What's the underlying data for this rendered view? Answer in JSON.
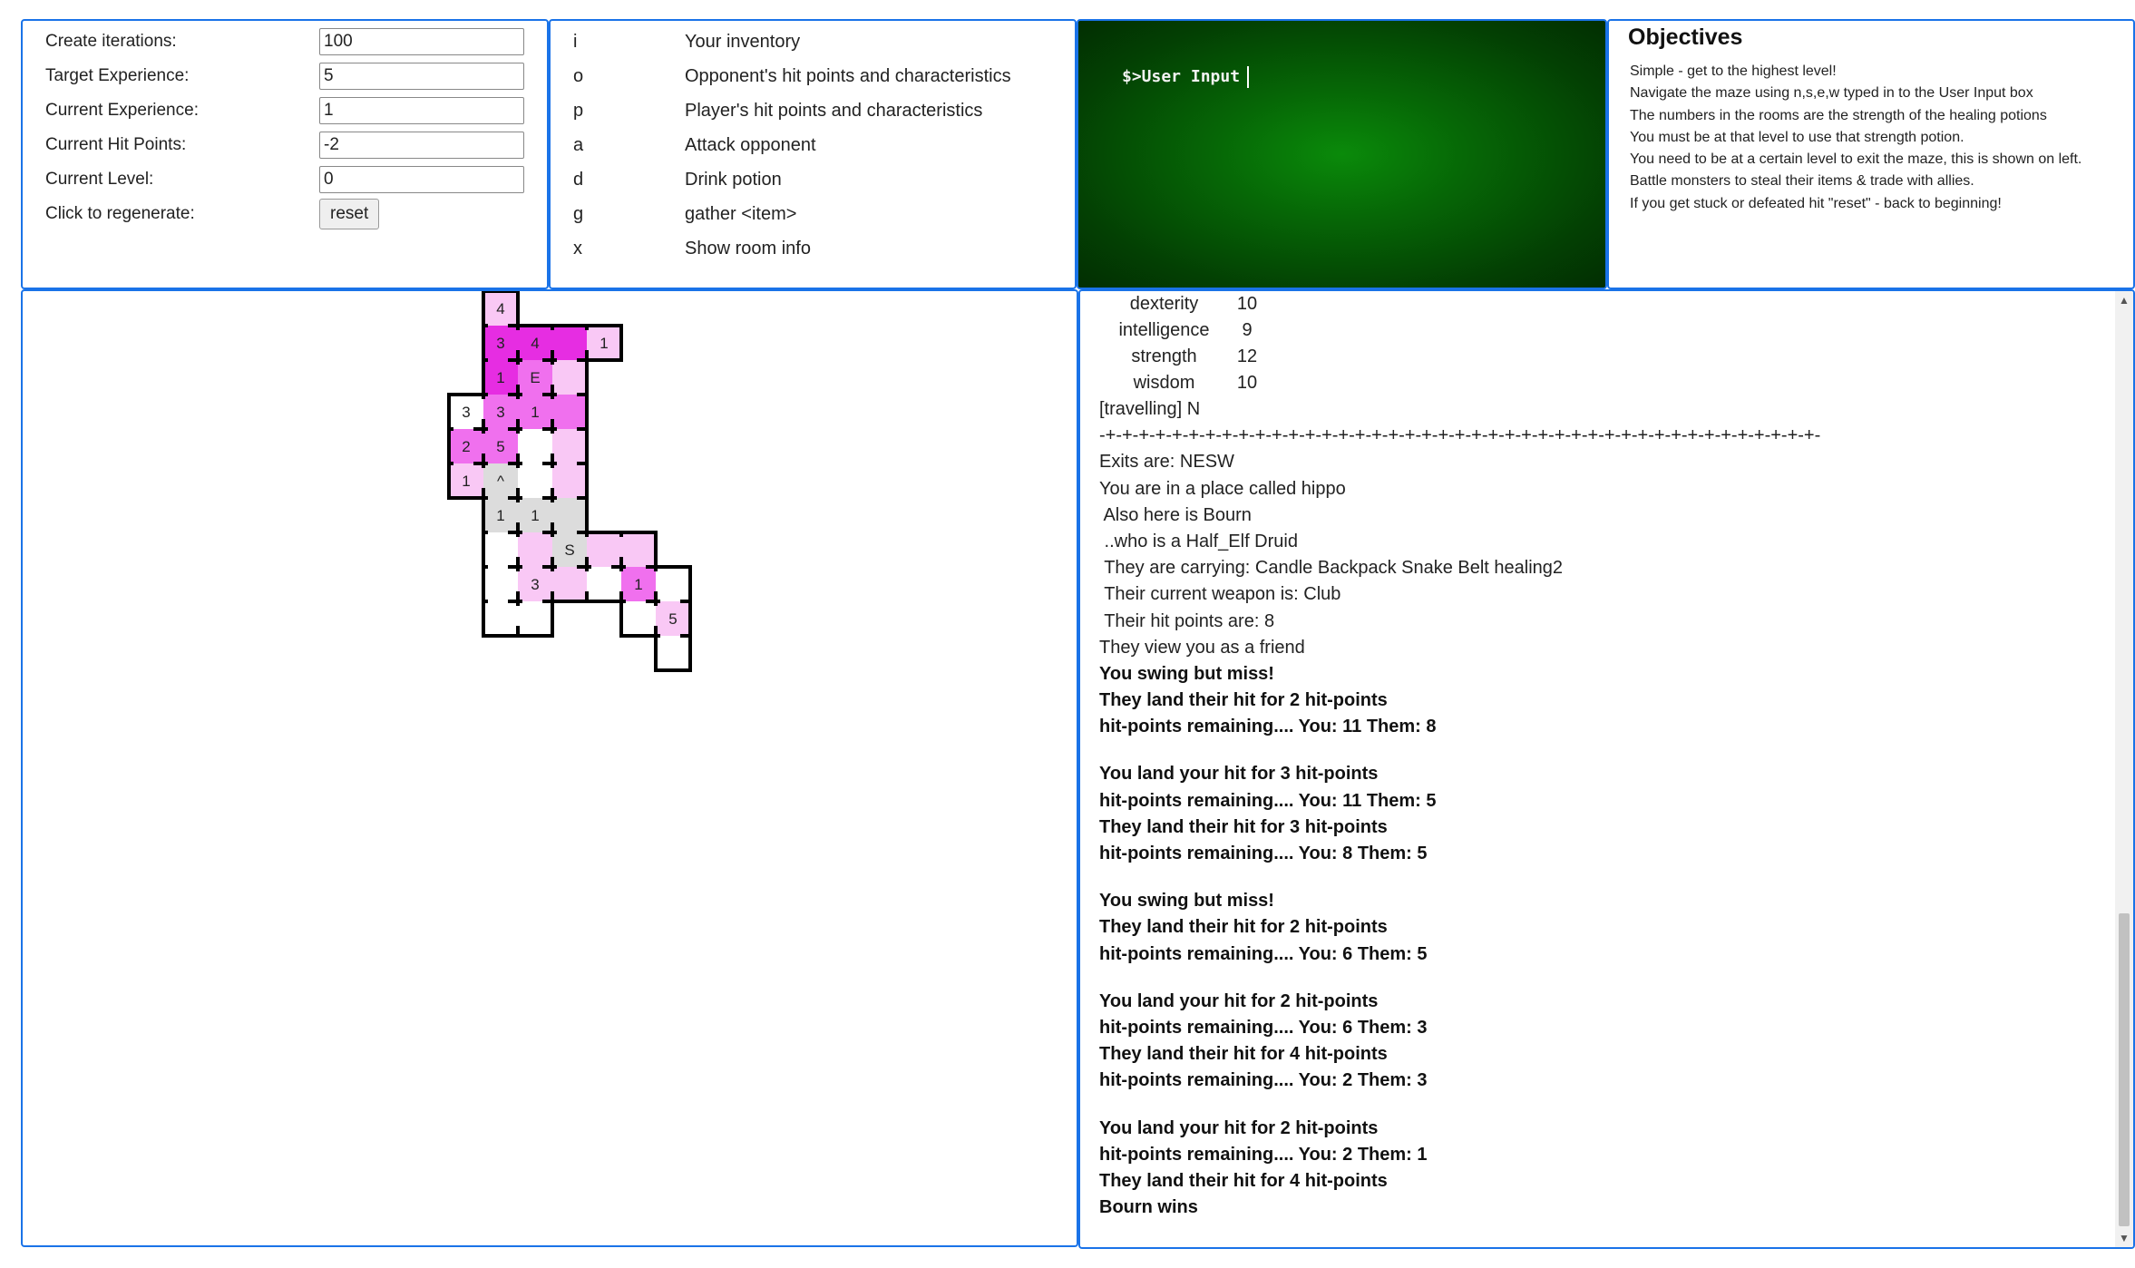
{
  "settings": {
    "rows": [
      {
        "label": "Create iterations:",
        "value": "100"
      },
      {
        "label": "Target Experience:",
        "value": "5"
      },
      {
        "label": "Current Experience:",
        "value": "1"
      },
      {
        "label": "Current Hit Points:",
        "value": "-2"
      },
      {
        "label": "Current Level:",
        "value": "0"
      }
    ],
    "regen_label": "Click to regenerate:",
    "reset_label": "reset"
  },
  "commands": [
    {
      "key": "i",
      "desc": "Your inventory"
    },
    {
      "key": "o",
      "desc": "Opponent's hit points and characteristics"
    },
    {
      "key": "p",
      "desc": "Player's hit points and characteristics"
    },
    {
      "key": "a",
      "desc": "Attack opponent"
    },
    {
      "key": "d",
      "desc": "Drink potion"
    },
    {
      "key": "g",
      "desc": "gather <item>"
    },
    {
      "key": "x",
      "desc": "Show room info"
    }
  ],
  "terminal": {
    "prompt": "$>User Input"
  },
  "objectives": {
    "title": "Objectives",
    "items": [
      "Simple - get to the highest level!",
      "Navigate the maze using n,s,e,w typed in to the User Input box",
      "The numbers in the rooms are the strength of the healing potions",
      "You must be at that level to use that strength potion.",
      "You need to be at a certain level to exit the maze, this is shown on left.",
      "Battle monsters to steal their items & trade with allies.",
      "If you get stuck or defeated hit \"reset\" - back to beginning!"
    ]
  },
  "log": {
    "stats": [
      {
        "name": "dexterity",
        "value": "10"
      },
      {
        "name": "intelligence",
        "value": "9"
      },
      {
        "name": "strength",
        "value": "12"
      },
      {
        "name": "wisdom",
        "value": "10"
      }
    ],
    "lines": [
      {
        "text": "[travelling] N"
      },
      {
        "text": "-+-+-+-+-+-+-+-+-+-+-+-+-+-+-+-+-+-+-+-+-+-+-+-+-+-+-+-+-+-+-+-+-+-+-+-+-+-+-+-+-+-+-+-"
      },
      {
        "text": "Exits are: NESW"
      },
      {
        "text": "You are in a place called hippo"
      },
      {
        "text": " Also here is Bourn"
      },
      {
        "text": " ..who is a Half_Elf Druid"
      },
      {
        "text": " They are carrying: Candle Backpack Snake Belt healing2"
      },
      {
        "text": " Their current weapon is: Club"
      },
      {
        "text": " Their hit points are: 8"
      },
      {
        "text": "They view you as a friend"
      }
    ],
    "combat": [
      [
        "You swing but miss!",
        "They land their hit for 2 hit-points",
        "hit-points remaining.... You: 11 Them: 8"
      ],
      [
        "You land your hit for 3 hit-points",
        "hit-points remaining.... You: 11 Them: 5",
        "They land their hit for 3 hit-points",
        "hit-points remaining.... You: 8 Them: 5"
      ],
      [
        "You swing but miss!",
        "They land their hit for 2 hit-points",
        "hit-points remaining.... You: 6 Them: 5"
      ],
      [
        "You land your hit for 2 hit-points",
        "hit-points remaining.... You: 6 Them: 3",
        "They land their hit for 4 hit-points",
        "hit-points remaining.... You: 2 Them: 3"
      ],
      [
        "You land your hit for 2 hit-points",
        "hit-points remaining.... You: 2 Them: 1",
        "They land their hit for 4 hit-points",
        "Bourn wins"
      ]
    ]
  },
  "maze": {
    "colors": {
      "light": "#f9c8f5",
      "medium": "#f070ee",
      "strong": "#e62de2",
      "visited": "#dcdcdc",
      "empty": "#ffffff"
    },
    "labels": [
      "4",
      "3",
      "4",
      "1",
      "1",
      "E",
      "3",
      "3",
      "1",
      "2",
      "5",
      "1",
      "^",
      "1",
      "1",
      "S",
      "3",
      "1",
      "5"
    ]
  }
}
